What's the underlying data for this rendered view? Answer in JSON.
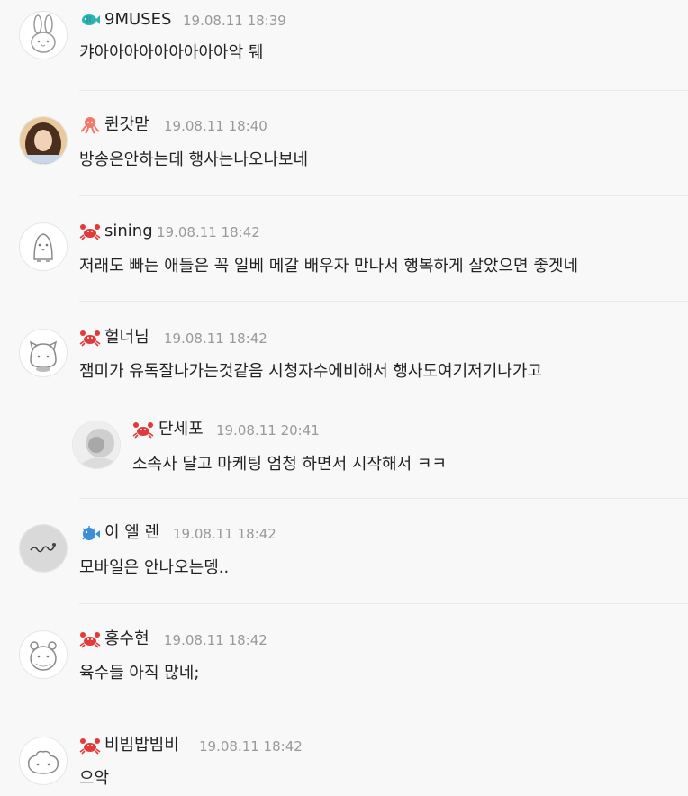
{
  "comments": [
    {
      "nick": "9MUSES",
      "date": "19.08.11 18:39",
      "text": "캬아아아아아아아아아악 퉤",
      "badge": "fish-badge-icon",
      "avatar": "bunny-avatar-icon"
    },
    {
      "nick": "퀸갓맏",
      "date": "19.08.11 18:40",
      "text": "방송은안하는데 행사는나오나보네",
      "badge": "octopus-badge-icon",
      "avatar": "user-photo-avatar"
    },
    {
      "nick": "sining",
      "date": "19.08.11 18:42",
      "text": "저래도 빠는 애들은 꼭 일베 메갈 배우자 만나서 행복하게 살았으면 좋겟네",
      "badge": "crab-badge-icon",
      "avatar": "penguin-avatar-icon"
    },
    {
      "nick": "헐너님",
      "date": "19.08.11 18:42",
      "text": "잼미가 유독잘나가는것같음 시청자수에비해서 행사도여기저기나가고",
      "badge": "crab-badge-icon",
      "avatar": "cat-avatar-icon"
    },
    {
      "nick": "단세포",
      "date": "19.08.11 20:41",
      "text": "소속사 달고 마케팅 엄청 하면서 시작해서 ㅋㅋ",
      "badge": "crab-badge-icon",
      "avatar": "photo-avatar"
    },
    {
      "nick": "이 엘 렌",
      "date": "19.08.11 18:42",
      "text": "모바일은 안나오는뎅..",
      "badge": "pufferfish-badge-icon",
      "avatar": "signature-avatar"
    },
    {
      "nick": "홍수현",
      "date": "19.08.11 18:42",
      "text": "육수들 아직 많네;",
      "badge": "crab-badge-icon",
      "avatar": "bear-avatar-icon"
    },
    {
      "nick": "비빔밥빔비",
      "date": "19.08.11 18:42",
      "text": "으악",
      "badge": "crab-badge-icon",
      "avatar": "sheep-avatar-icon"
    }
  ],
  "colors": {
    "background": "#f8f8f8",
    "crab": "#e03a3a",
    "octopus": "#ef7a6b",
    "fish": "#2bb3b3",
    "pufferfish": "#3a8fd6"
  }
}
